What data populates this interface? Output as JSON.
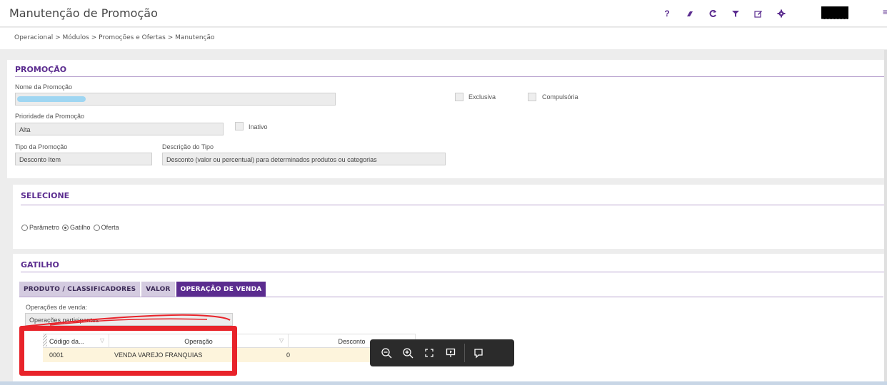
{
  "header": {
    "title": "Manutenção de Promoção",
    "toolbar": [
      {
        "name": "help-icon",
        "glyph": "?"
      },
      {
        "name": "eraser-icon",
        "glyph": ""
      },
      {
        "name": "refresh-icon",
        "glyph": ""
      },
      {
        "name": "filter-icon",
        "glyph": ""
      },
      {
        "name": "edit-icon",
        "glyph": ""
      },
      {
        "name": "gear-icon",
        "glyph": ""
      }
    ]
  },
  "breadcrumb": "Operacional > Módulos > Promoções e Ofertas > Manutenção",
  "promocao": {
    "title": "PROMOÇÃO",
    "nome_label": "Nome da Promoção",
    "nome_value": "",
    "exclusiva_label": "Exclusiva",
    "compulsoria_label": "Compulsória",
    "prioridade_label": "Prioridade da Promoção",
    "prioridade_value": "Alta",
    "inativo_label": "Inativo",
    "tipo_label": "Tipo da Promoção",
    "tipo_value": "Desconto Item",
    "descricao_label": "Descrição do Tipo",
    "descricao_value": "Desconto (valor ou percentual) para determinados produtos ou categorias"
  },
  "selecione": {
    "title": "SELECIONE",
    "options": [
      "Parâmetro",
      "Gatilho",
      "Oferta"
    ],
    "selected": "Gatilho"
  },
  "gatilho": {
    "title": "GATILHO",
    "tabs": [
      "PRODUTO / CLASSIFICADORES",
      "VALOR",
      "OPERAÇÃO DE VENDA"
    ],
    "active_tab": "OPERAÇÃO DE VENDA",
    "operacoes_label": "Operações de venda:",
    "operacoes_value": "Operações participantes",
    "grid": {
      "columns": [
        "Código da...",
        "Operação",
        "Desconto"
      ],
      "rows": [
        {
          "codigo": "0001",
          "operacao": "VENDA VAREJO FRANQUIAS",
          "desconto": "0"
        }
      ]
    }
  },
  "colors": {
    "accent": "#5b2c8f",
    "annotation": "#e8232a",
    "row_highlight": "#fdf4dc"
  }
}
